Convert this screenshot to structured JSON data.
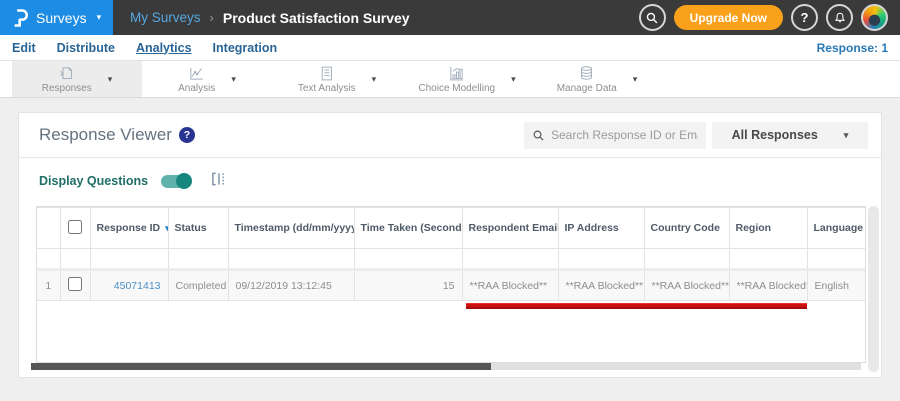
{
  "topbar": {
    "app_menu_label": "Surveys",
    "breadcrumb": [
      "My Surveys",
      "Product Satisfaction Survey"
    ],
    "upgrade_label": "Upgrade Now",
    "help_glyph": "?"
  },
  "nav": {
    "items": [
      "Edit",
      "Distribute",
      "Analytics",
      "Integration"
    ],
    "active": "Analytics",
    "response_count_label": "Response: 1"
  },
  "toolbar": {
    "items": [
      {
        "label": "Responses",
        "icon": "responses-icon",
        "active": true
      },
      {
        "label": "Analysis",
        "icon": "analysis-icon",
        "active": false
      },
      {
        "label": "Text Analysis",
        "icon": "text-analysis-icon",
        "active": false
      },
      {
        "label": "Choice Modelling",
        "icon": "choice-modelling-icon",
        "active": false
      },
      {
        "label": "Manage Data",
        "icon": "manage-data-icon",
        "active": false
      }
    ]
  },
  "viewer": {
    "title": "Response Viewer",
    "help_glyph": "?",
    "search_placeholder": "Search Response ID or Email",
    "responses_filter_value": "All Responses",
    "display_questions_label": "Display Questions",
    "display_questions_on": true
  },
  "table": {
    "columns": [
      {
        "label": "",
        "name": "row-number"
      },
      {
        "label": "",
        "name": "select-all"
      },
      {
        "label": "Response ID",
        "sort_icon": "▾",
        "sort": "desc"
      },
      {
        "label": "Status",
        "sort": null
      },
      {
        "label": "Timestamp (dd/mm/yyyy)",
        "sort_icon": "⇅",
        "sort": "both"
      },
      {
        "label": "Time Taken (Seconds)",
        "sort_icon": "⇅",
        "sort": "both"
      },
      {
        "label": "Respondent Email",
        "sort": null
      },
      {
        "label": "IP Address",
        "sort": null
      },
      {
        "label": "Country Code",
        "sort": null
      },
      {
        "label": "Region",
        "sort": null
      },
      {
        "label": "Language",
        "sort": null
      }
    ],
    "rows": [
      {
        "num": "1",
        "response_id": "45071413",
        "status": "Completed",
        "timestamp": "09/12/2019 13:12:45",
        "time_taken": "15",
        "respondent_email": "**RAA Blocked**",
        "ip_address": "**RAA Blocked**",
        "country_code": "**RAA Blocked**",
        "region": "**RAA Blocked**",
        "language": "English"
      }
    ]
  },
  "annotation": {
    "type": "red-underline",
    "covers": [
      "Respondent Email",
      "IP Address",
      "Country Code",
      "Region"
    ],
    "color": "#d01010"
  },
  "colors": {
    "brand_blue": "#1d8ce4",
    "topbar_dark": "#3a3a3a",
    "upgrade_orange": "#f9a11b",
    "nav_link_blue": "#2a6496",
    "toggle_teal": "#17877d",
    "link_blue": "#4a90c9",
    "annotation_red": "#d01010"
  }
}
